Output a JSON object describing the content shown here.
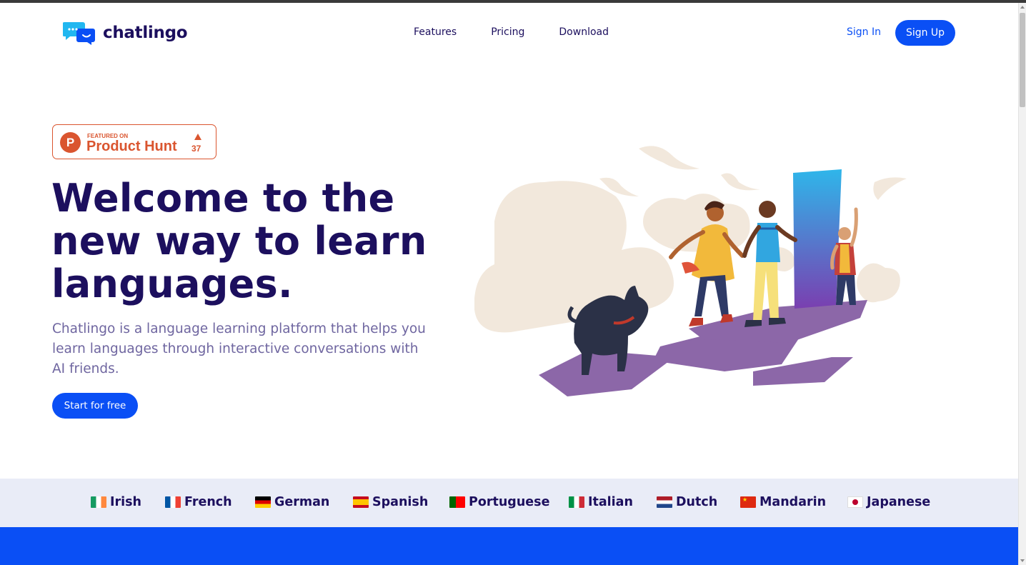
{
  "brand": {
    "name": "chatlingo"
  },
  "nav": {
    "features": "Features",
    "pricing": "Pricing",
    "download": "Download"
  },
  "auth": {
    "signin": "Sign In",
    "signup": "Sign Up"
  },
  "product_hunt": {
    "featured": "FEATURED ON",
    "name": "Product Hunt",
    "count": "37",
    "logo_letter": "P"
  },
  "hero": {
    "title": "Welcome to the new way to learn languages.",
    "description": "Chatlingo is a language learning platform that helps you learn languages through interactive conversations with AI friends.",
    "cta": "Start for free"
  },
  "languages": [
    {
      "name": "Irish",
      "flag": "flag-ireland-icon"
    },
    {
      "name": "French",
      "flag": "flag-france-icon"
    },
    {
      "name": "German",
      "flag": "flag-germany-icon"
    },
    {
      "name": "Spanish",
      "flag": "flag-spain-icon"
    },
    {
      "name": "Portuguese",
      "flag": "flag-portugal-icon"
    },
    {
      "name": "Italian",
      "flag": "flag-italy-icon"
    },
    {
      "name": "Dutch",
      "flag": "flag-netherlands-icon"
    },
    {
      "name": "Mandarin",
      "flag": "flag-china-icon"
    },
    {
      "name": "Japanese",
      "flag": "flag-japan-icon"
    }
  ],
  "colors": {
    "primary": "#0a4ff5",
    "navy": "#1c0f5e",
    "product_hunt": "#da552f",
    "lang_bar": "#e9ecf7"
  }
}
